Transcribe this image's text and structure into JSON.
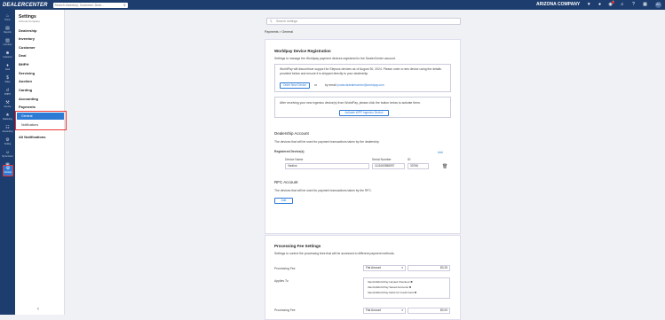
{
  "topbar": {
    "logo": "DEALERCENTER",
    "search_placeholder": "Search Inventory, Customer, Deal...",
    "company": "ARIZONA COMPANY",
    "notif_count": "3",
    "avatar": "AC"
  },
  "rail": {
    "items": [
      "Home",
      "Reports",
      "Inventory",
      "Customer",
      "Deal",
      "Sales",
      "BHPH",
      "Service",
      "Marketing",
      "Accounting",
      "Setting",
      "My Account",
      "Apps",
      "Settings"
    ]
  },
  "settings_nav": {
    "title": "Settings",
    "subtitle": "Arizona Company",
    "items": [
      "Dealership",
      "Inventory",
      "Customer",
      "Deal",
      "BHPH",
      "Servicing",
      "Auction",
      "Carding",
      "Accounting",
      "Payments"
    ],
    "sub_items": [
      "General",
      "Notifications"
    ],
    "all_notifications": "All Notifications"
  },
  "main": {
    "search_placeholder": "Search settings",
    "breadcrumb": "Payments  >  General",
    "worldpay": {
      "title": "Worldpay Device Registration",
      "desc": "Settings to manage the Worldpay payment devices registered to the DealerCenter account.",
      "notice": "WorldPay will discontinue support for Elepsos devices as of August 30, 2024. Please order a new device using the details provided below and ensure it is shipped directly to your dealership.",
      "order_btn": "Order New Device",
      "or": "or",
      "by_email": "by email:",
      "email": "productsdealercenter@worldpay.com",
      "activate_text": "After receiving your new ingenico device(s) from WorldPay, please click the button below to activate them.",
      "activate_btn": "Activate WPP Ingenico Device"
    },
    "dealership_account": {
      "title": "Dealership Account",
      "desc": "The devices that will be used for payment transactions taken by the dealership.",
      "registered_label": "Registered Device(s)",
      "add": "Add",
      "col_name": "Device Name",
      "col_serial": "Serial Number",
      "col_id": "ID",
      "name": "Vantiva",
      "serial": "1111063558097",
      "id": "33766"
    },
    "rfc_account": {
      "title": "RFC Account",
      "desc": "The devices that will be used for payment transactions taken by the RFC.",
      "add": "Add"
    },
    "processing": {
      "title": "Processing Fee Settings",
      "desc": "Settings to control the processing fees that will be accessed to different payment methods.",
      "fee_label": "Processing Fee",
      "fee_type": "Flat Amount",
      "fee_amount": "$3.25",
      "applies_label": "Applies To",
      "applies": [
        "Vamtiv/World Pay Hosted Checkout",
        "Vamtiv/World Pay Saved Accounts",
        "Vamtiv/World Pay Debit Or Credit Card"
      ],
      "fee2_label": "Processing Fee",
      "fee2_type": "Flat Amount",
      "fee2_amount": "$0.00"
    }
  }
}
